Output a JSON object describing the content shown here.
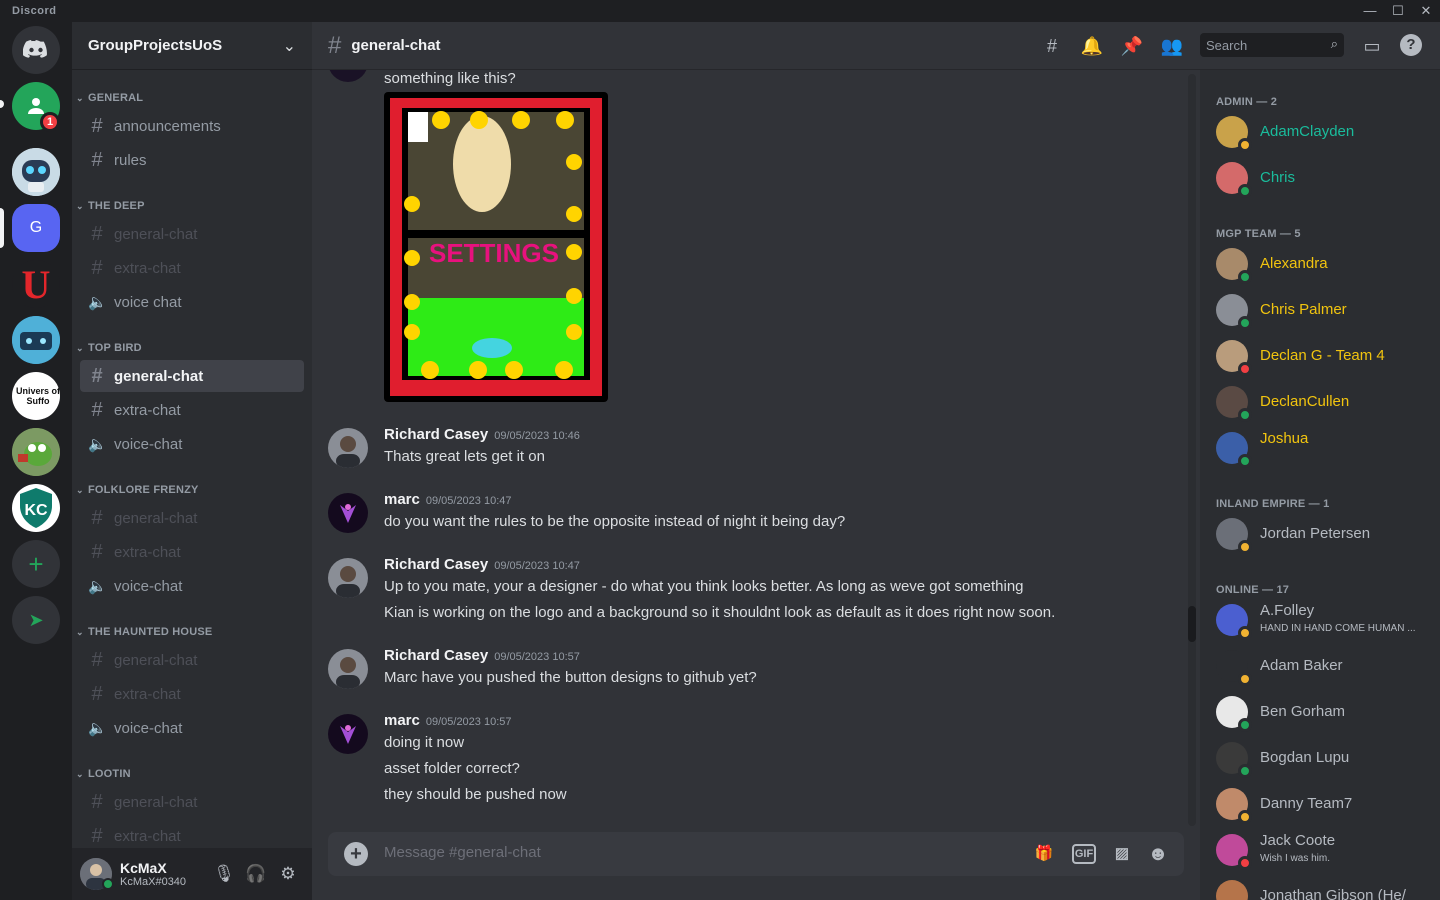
{
  "window": {
    "title": "Discord",
    "minimize": "—",
    "maximize": "☐",
    "close": "✕"
  },
  "rail": {
    "badge_count": "1",
    "servers": [
      {
        "name": "Direct Messages",
        "initial": ""
      },
      {
        "name": "Friends group",
        "initial": ""
      },
      {
        "name": "Robot server",
        "initial": ""
      },
      {
        "name": "GroupProjectsUoS",
        "initial": "G"
      },
      {
        "name": "U server",
        "initial": "U"
      },
      {
        "name": "Game server",
        "initial": ""
      },
      {
        "name": "University of Suffolk",
        "initial": "Univers of Suffo"
      },
      {
        "name": "Kermit server",
        "initial": ""
      },
      {
        "name": "KC server",
        "initial": "KC"
      }
    ],
    "add": "+",
    "explore": "➤"
  },
  "guild": {
    "name": "GroupProjectsUoS",
    "chevron": "⌄"
  },
  "categories": [
    {
      "name": "GENERAL",
      "channels": [
        {
          "name": "announcements",
          "type": "text"
        },
        {
          "name": "rules",
          "type": "text"
        }
      ]
    },
    {
      "name": "THE DEEP",
      "channels": [
        {
          "name": "general-chat",
          "type": "text"
        },
        {
          "name": "extra-chat",
          "type": "text"
        },
        {
          "name": "voice chat",
          "type": "voice"
        }
      ]
    },
    {
      "name": "TOP BIRD",
      "channels": [
        {
          "name": "general-chat",
          "type": "text"
        },
        {
          "name": "extra-chat",
          "type": "text"
        },
        {
          "name": "voice-chat",
          "type": "voice"
        }
      ]
    },
    {
      "name": "FOLKLORE FRENZY",
      "channels": [
        {
          "name": "general-chat",
          "type": "text"
        },
        {
          "name": "extra-chat",
          "type": "text"
        },
        {
          "name": "voice-chat",
          "type": "voice"
        }
      ]
    },
    {
      "name": "THE HAUNTED HOUSE",
      "channels": [
        {
          "name": "general-chat",
          "type": "text"
        },
        {
          "name": "extra-chat",
          "type": "text"
        },
        {
          "name": "voice-chat",
          "type": "voice"
        }
      ]
    },
    {
      "name": "LOOTIN",
      "channels": [
        {
          "name": "general-chat",
          "type": "text"
        },
        {
          "name": "extra-chat",
          "type": "text"
        }
      ]
    }
  ],
  "user": {
    "name": "KcMaX",
    "tag": "KcMaX#0340"
  },
  "channel": {
    "name": "general-chat",
    "search_placeholder": "Search"
  },
  "messages": {
    "first_line": "something like this?",
    "image_text": "SETTINGS",
    "m1": {
      "author": "Richard Casey",
      "time": "09/05/2023 10:46",
      "lines": [
        "Thats great lets get it on"
      ]
    },
    "m2": {
      "author": "marc",
      "time": "09/05/2023 10:47",
      "lines": [
        "do you want the rules to be the opposite instead of night it being day?"
      ]
    },
    "m3": {
      "author": "Richard Casey",
      "time": "09/05/2023 10:47",
      "lines": [
        "Up to you mate, your a designer - do what you think looks better. As long as weve got something",
        "Kian is working on the logo and a background so it shouldnt look as default as it does right now soon."
      ]
    },
    "m4": {
      "author": "Richard Casey",
      "time": "09/05/2023 10:57",
      "lines": [
        "Marc have you pushed the button designs to github yet?"
      ]
    },
    "m5": {
      "author": "marc",
      "time": "09/05/2023 10:57",
      "lines": [
        "doing it now",
        "asset folder correct?",
        "they should be pushed now"
      ]
    }
  },
  "composer": {
    "placeholder": "Message #general-chat",
    "gif": "GIF"
  },
  "members": {
    "groups": [
      {
        "title": "ADMIN — 2"
      },
      {
        "title": "MGP TEAM — 5"
      },
      {
        "title": "INLAND EMPIRE — 1"
      },
      {
        "title": "ONLINE — 17"
      }
    ],
    "list": [
      {
        "name": "AdamClayden",
        "color": "#1abc9c",
        "status": "idle"
      },
      {
        "name": "Chris",
        "color": "#1abc9c",
        "status": "online"
      },
      {
        "name": "Alexandra",
        "color": "#f1c40f",
        "status": "online"
      },
      {
        "name": "Chris Palmer",
        "color": "#f1c40f",
        "status": "online"
      },
      {
        "name": "Declan G - Team 4",
        "color": "#f1c40f",
        "status": "dnd"
      },
      {
        "name": "DeclanCullen",
        "color": "#f1c40f",
        "status": "online"
      },
      {
        "name": "Joshua",
        "color": "#f1c40f",
        "status": "online"
      },
      {
        "name": "Jordan Petersen",
        "color": "#b5bac1",
        "status": "idle"
      },
      {
        "name": "A.Folley",
        "color": "#b5bac1",
        "status": "idle",
        "custom": "HAND IN HAND COME HUMAN ..."
      },
      {
        "name": "Adam Baker",
        "color": "#b5bac1",
        "status": "idle"
      },
      {
        "name": "Ben Gorham",
        "color": "#b5bac1",
        "status": "online"
      },
      {
        "name": "Bogdan Lupu",
        "color": "#b5bac1",
        "status": "online"
      },
      {
        "name": "Danny Team7",
        "color": "#b5bac1",
        "status": "idle"
      },
      {
        "name": "Jack Coote",
        "color": "#b5bac1",
        "status": "dnd",
        "custom": "Wish I was him."
      },
      {
        "name": "Jonathan Gibson (He/",
        "color": "#b5bac1",
        "status": "online"
      }
    ]
  },
  "colors": {
    "online": "#23a55a",
    "idle": "#f0b232",
    "dnd": "#f23f43",
    "accent": "#5865f2"
  }
}
